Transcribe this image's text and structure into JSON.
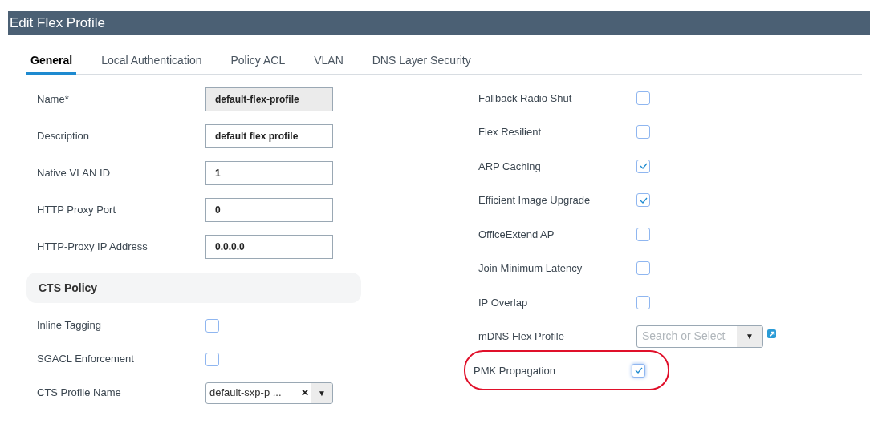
{
  "window": {
    "title": "Edit Flex Profile"
  },
  "tabs": [
    {
      "label": "General",
      "selected": true
    },
    {
      "label": "Local Authentication",
      "selected": false
    },
    {
      "label": "Policy ACL",
      "selected": false
    },
    {
      "label": "VLAN",
      "selected": false
    },
    {
      "label": "DNS Layer Security",
      "selected": false
    }
  ],
  "left_fields": [
    {
      "kind": "input",
      "label": "Name*",
      "value": "default-flex-profile",
      "disabled": true
    },
    {
      "kind": "input",
      "label": "Description",
      "value": "default flex profile",
      "disabled": false
    },
    {
      "kind": "input",
      "label": "Native VLAN ID",
      "value": "1",
      "disabled": false
    },
    {
      "kind": "input",
      "label": "HTTP Proxy Port",
      "value": "0",
      "disabled": false
    },
    {
      "kind": "input",
      "label": "HTTP-Proxy IP Address",
      "value": "0.0.0.0",
      "disabled": false
    },
    {
      "kind": "section",
      "label": "CTS Policy"
    },
    {
      "kind": "checkbox",
      "label": "Inline Tagging",
      "checked": false
    },
    {
      "kind": "checkbox",
      "label": "SGACL Enforcement",
      "checked": false
    },
    {
      "kind": "select",
      "label": "CTS Profile Name",
      "value": "default-sxp-p ...",
      "clear": "✕",
      "caret": "▼"
    }
  ],
  "right_fields": [
    {
      "kind": "checkbox",
      "label": "Fallback Radio Shut",
      "checked": false,
      "highlighted": false
    },
    {
      "kind": "checkbox",
      "label": "Flex Resilient",
      "checked": false,
      "highlighted": false
    },
    {
      "kind": "checkbox",
      "label": "ARP Caching",
      "checked": true,
      "highlighted": false
    },
    {
      "kind": "checkbox",
      "label": "Efficient Image Upgrade",
      "checked": true,
      "highlighted": false
    },
    {
      "kind": "checkbox",
      "label": "OfficeExtend AP",
      "checked": false,
      "highlighted": false
    },
    {
      "kind": "checkbox",
      "label": "Join Minimum Latency",
      "checked": false,
      "highlighted": false
    },
    {
      "kind": "checkbox",
      "label": "IP Overlap",
      "checked": false,
      "highlighted": false
    },
    {
      "kind": "select",
      "label": "mDNS Flex Profile",
      "placeholder": "Search or Select",
      "caret": "▼",
      "highlighted": false
    },
    {
      "kind": "checkbox",
      "label": "PMK Propagation",
      "checked": true,
      "highlighted": true
    }
  ]
}
